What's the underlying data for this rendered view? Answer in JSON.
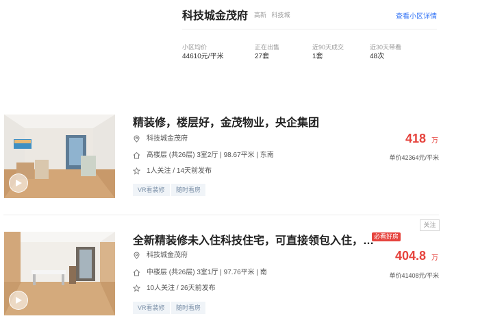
{
  "community": {
    "name": "科技城金茂府",
    "tags": [
      "高新",
      "科技城"
    ],
    "detail_link": "查看小区详情",
    "stats": [
      {
        "label": "小区均价",
        "value": "44610元/平米"
      },
      {
        "label": "正在出售",
        "value": "27套"
      },
      {
        "label": "近90天成交",
        "value": "1套"
      },
      {
        "label": "近30天带看",
        "value": "48次"
      }
    ]
  },
  "listings": [
    {
      "title": "精装修，楼层好，金茂物业，央企集团",
      "community": "科技城金茂府",
      "layout": "高楼层 (共26层) 3室2厅 | 98.67平米 | 东南",
      "followers": "1人关注 / 14天前发布",
      "tags": [
        "VR看装修",
        "随时看房"
      ],
      "price": "418",
      "price_unit": "万",
      "unit_price": "单价42364元/平米"
    },
    {
      "title": "全新精装修未入住科技住宅，可直接领包入住，…",
      "badge": "必看好房",
      "follow_label": "关注",
      "community": "科技城金茂府",
      "layout": "中楼层 (共26层) 3室1厅 | 97.76平米 | 南",
      "followers": "10人关注 / 26天前发布",
      "tags": [
        "VR看装修",
        "随时看房"
      ],
      "price": "404.8",
      "price_unit": "万",
      "unit_price": "单价41408元/平米"
    }
  ],
  "icons": {
    "location": "location-pin-icon",
    "house": "house-icon",
    "star": "star-icon",
    "vr": "vr-play-icon"
  },
  "colors": {
    "price": "#e6443e",
    "link": "#3072f6",
    "tag_bg": "#f0f4f8",
    "tag_text": "#7b90a8"
  }
}
